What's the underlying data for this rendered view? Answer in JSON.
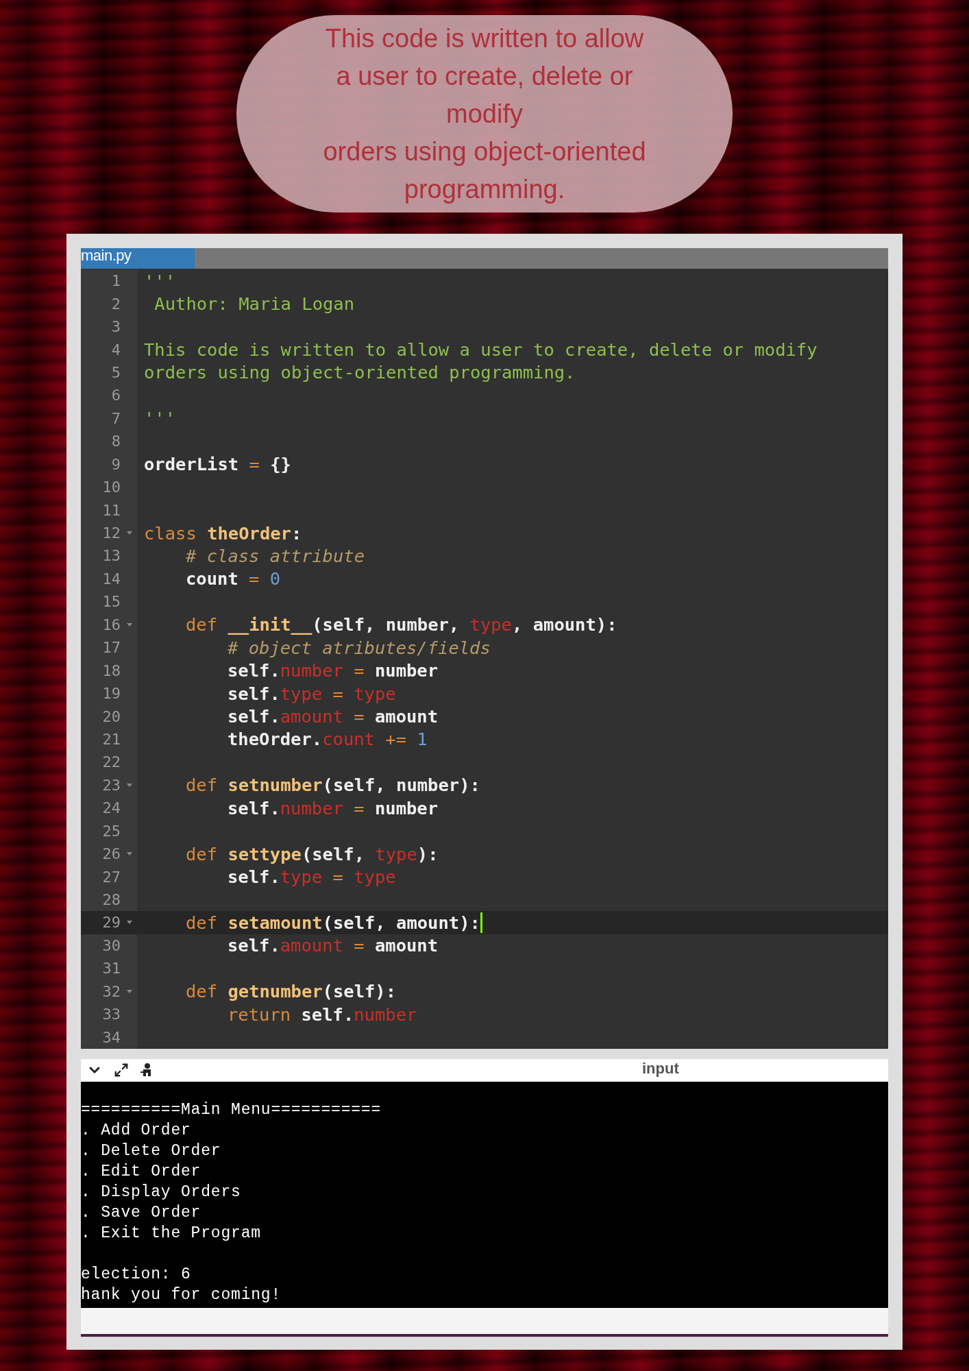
{
  "caption": {
    "lines": [
      "This code is written to allow",
      "a user to create, delete or",
      "modify",
      "orders using object-oriented",
      "programming."
    ]
  },
  "editor": {
    "tabs": [
      {
        "label": "main.py",
        "selected": true
      }
    ],
    "lines": [
      {
        "number": "1",
        "foldable": false,
        "active": false,
        "kind": "top",
        "tokens": [
          {
            "kind": "str",
            "text": "'''"
          }
        ]
      },
      {
        "number": "2",
        "foldable": false,
        "active": false,
        "kind": "top",
        "tokens": [
          {
            "kind": "str",
            "text": " Author: Maria Logan"
          }
        ]
      },
      {
        "number": "3",
        "foldable": false,
        "active": false
      },
      {
        "number": "4",
        "foldable": false,
        "active": false,
        "kind": "top",
        "tokens": [
          {
            "kind": "str",
            "text": "This code is written to allow a user to create, delete or modify"
          }
        ]
      },
      {
        "number": "5",
        "foldable": false,
        "active": false,
        "kind": "top",
        "tokens": [
          {
            "kind": "str",
            "text": "orders using object-oriented programming."
          }
        ]
      },
      {
        "number": "6",
        "foldable": false,
        "active": false
      },
      {
        "number": "7",
        "foldable": false,
        "active": false,
        "kind": "top",
        "tokens": [
          {
            "kind": "str",
            "text": "'''"
          }
        ]
      },
      {
        "number": "8",
        "foldable": false,
        "active": false
      },
      {
        "number": "9",
        "foldable": false,
        "active": false,
        "kind": "top",
        "tokens": [
          {
            "kind": "name",
            "text": "orderList"
          },
          {
            "kind": "op",
            "text": " = "
          },
          {
            "kind": "name",
            "text": "{}"
          }
        ]
      },
      {
        "number": "10",
        "foldable": false,
        "active": false
      },
      {
        "number": "11",
        "foldable": false,
        "active": false
      },
      {
        "number": "12",
        "foldable": true,
        "active": false,
        "kind": "top",
        "tokens": [
          {
            "kind": "kw",
            "text": "class "
          },
          {
            "kind": "fn",
            "text": "theOrder"
          },
          {
            "kind": "name",
            "text": ":"
          }
        ]
      },
      {
        "number": "13",
        "foldable": false,
        "active": false,
        "kind": "member",
        "tokens": [
          {
            "kind": "com",
            "text": "# class attribute"
          }
        ]
      },
      {
        "number": "14",
        "foldable": false,
        "active": false,
        "kind": "member",
        "tokens": [
          {
            "kind": "name",
            "text": "count"
          },
          {
            "kind": "op",
            "text": " = "
          },
          {
            "kind": "num",
            "text": "0"
          }
        ]
      },
      {
        "number": "15",
        "foldable": false,
        "active": false
      },
      {
        "number": "16",
        "foldable": true,
        "active": false,
        "kind": "member",
        "tokens": [
          {
            "kind": "kw",
            "text": "def "
          },
          {
            "kind": "fn",
            "text": "__init__"
          },
          {
            "kind": "name",
            "text": "(self, number, "
          },
          {
            "kind": "attr",
            "text": "type"
          },
          {
            "kind": "name",
            "text": ", amount):"
          }
        ]
      },
      {
        "number": "17",
        "foldable": false,
        "active": false,
        "kind": "inner",
        "tokens": [
          {
            "kind": "com",
            "text": "# object atributes/fields"
          }
        ]
      },
      {
        "number": "18",
        "foldable": false,
        "active": false,
        "kind": "inner",
        "tokens": [
          {
            "kind": "name",
            "text": "self."
          },
          {
            "kind": "attr",
            "text": "number"
          },
          {
            "kind": "op",
            "text": " = "
          },
          {
            "kind": "name",
            "text": "number"
          }
        ]
      },
      {
        "number": "19",
        "foldable": false,
        "active": false,
        "kind": "inner",
        "tokens": [
          {
            "kind": "name",
            "text": "self."
          },
          {
            "kind": "attr",
            "text": "type"
          },
          {
            "kind": "op",
            "text": " = "
          },
          {
            "kind": "attr",
            "text": "type"
          }
        ]
      },
      {
        "number": "20",
        "foldable": false,
        "active": false,
        "kind": "inner",
        "tokens": [
          {
            "kind": "name",
            "text": "self."
          },
          {
            "kind": "attr",
            "text": "amount"
          },
          {
            "kind": "op",
            "text": " = "
          },
          {
            "kind": "name",
            "text": "amount"
          }
        ]
      },
      {
        "number": "21",
        "foldable": false,
        "active": false,
        "kind": "inner",
        "tokens": [
          {
            "kind": "name",
            "text": "theOrder."
          },
          {
            "kind": "attr",
            "text": "count"
          },
          {
            "kind": "op",
            "text": " += "
          },
          {
            "kind": "num",
            "text": "1"
          }
        ]
      },
      {
        "number": "22",
        "foldable": false,
        "active": false
      },
      {
        "number": "23",
        "foldable": true,
        "active": false,
        "kind": "member",
        "tokens": [
          {
            "kind": "kw",
            "text": "def "
          },
          {
            "kind": "fn",
            "text": "setnumber"
          },
          {
            "kind": "name",
            "text": "(self, number):"
          }
        ]
      },
      {
        "number": "24",
        "foldable": false,
        "active": false,
        "kind": "inner",
        "tokens": [
          {
            "kind": "name",
            "text": "self."
          },
          {
            "kind": "attr",
            "text": "number"
          },
          {
            "kind": "op",
            "text": " = "
          },
          {
            "kind": "name",
            "text": "number"
          }
        ]
      },
      {
        "number": "25",
        "foldable": false,
        "active": false
      },
      {
        "number": "26",
        "foldable": true,
        "active": false,
        "kind": "member",
        "tokens": [
          {
            "kind": "kw",
            "text": "def "
          },
          {
            "kind": "fn",
            "text": "settype"
          },
          {
            "kind": "name",
            "text": "(self, "
          },
          {
            "kind": "attr",
            "text": "type"
          },
          {
            "kind": "name",
            "text": "):"
          }
        ]
      },
      {
        "number": "27",
        "foldable": false,
        "active": false,
        "kind": "inner",
        "tokens": [
          {
            "kind": "name",
            "text": "self."
          },
          {
            "kind": "attr",
            "text": "type"
          },
          {
            "kind": "op",
            "text": " = "
          },
          {
            "kind": "attr",
            "text": "type"
          }
        ]
      },
      {
        "number": "28",
        "foldable": false,
        "active": false
      },
      {
        "number": "29",
        "foldable": true,
        "active": true,
        "kind": "member",
        "tokens": [
          {
            "kind": "kw",
            "text": "def "
          },
          {
            "kind": "fn",
            "text": "setamount"
          },
          {
            "kind": "name",
            "text": "(self, amount):"
          }
        ]
      },
      {
        "number": "30",
        "foldable": false,
        "active": false,
        "kind": "inner",
        "tokens": [
          {
            "kind": "name",
            "text": "self."
          },
          {
            "kind": "attr",
            "text": "amount"
          },
          {
            "kind": "op",
            "text": " = "
          },
          {
            "kind": "name",
            "text": "amount"
          }
        ]
      },
      {
        "number": "31",
        "foldable": false,
        "active": false
      },
      {
        "number": "32",
        "foldable": true,
        "active": false,
        "kind": "member",
        "tokens": [
          {
            "kind": "kw",
            "text": "def "
          },
          {
            "kind": "fn",
            "text": "getnumber"
          },
          {
            "kind": "name",
            "text": "(self):"
          }
        ]
      },
      {
        "number": "33",
        "foldable": false,
        "active": false,
        "kind": "inner",
        "tokens": [
          {
            "kind": "kw",
            "text": "return "
          },
          {
            "kind": "name",
            "text": "self."
          },
          {
            "kind": "attr",
            "text": "number"
          }
        ]
      },
      {
        "number": "34",
        "foldable": false,
        "active": false
      }
    ]
  },
  "console": {
    "label": "input",
    "menu": [
      "==========Main Menu===========",
      ". Add Order",
      ". Delete Order",
      ". Edit Order",
      ". Display Orders",
      ". Save Order",
      ". Exit the Program"
    ],
    "prompt": [
      "election: 6",
      "hank you for coming!"
    ]
  }
}
